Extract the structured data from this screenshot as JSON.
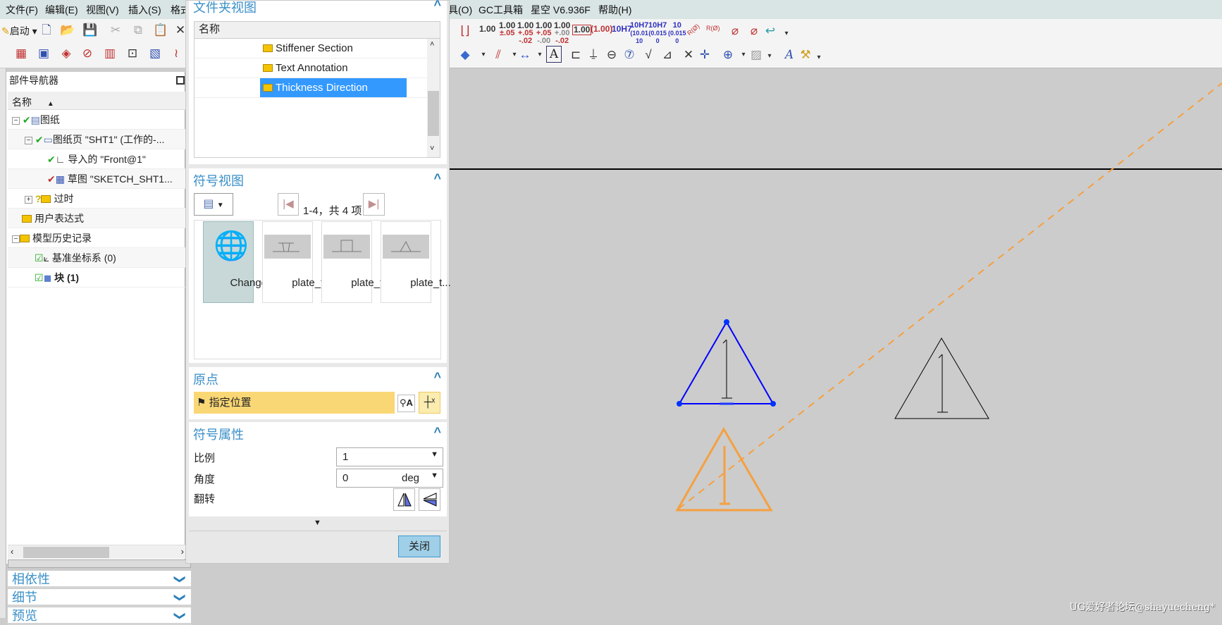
{
  "menubar": {
    "items_left": [
      "文件(F)",
      "编辑(E)",
      "视图(V)",
      "插入(S)",
      "格式"
    ],
    "items_right": [
      "工具(O)",
      "GC工具箱",
      "星空 V6.936F",
      "帮助(H)"
    ]
  },
  "toolbar_left": {
    "start_label": "启动",
    "row1_icons": [
      "new-file-icon",
      "open-folder-icon",
      "save-icon",
      "cut-icon",
      "copy-icon",
      "paste-icon",
      "close-icon"
    ],
    "row2_icons": [
      "view-layout-icon",
      "base-view-icon",
      "section-view-icon",
      "detail-view-icon",
      "break-view-icon",
      "section-line-icon",
      "hatch-icon",
      "broken-view-icon"
    ]
  },
  "toolbar_right": {
    "tolerance_styles": [
      {
        "main": "1.00",
        "upper": "",
        "lower": ""
      },
      {
        "main": "1.00",
        "upper": "±.05",
        "lower": ""
      },
      {
        "main": "1.00",
        "upper": "+.05",
        "lower": "-.02"
      },
      {
        "main": "1.00",
        "upper": "+.05",
        "lower": "-.00"
      },
      {
        "main": "1.00",
        "upper": "+.00",
        "lower": "-.02"
      },
      {
        "main": "1.00",
        "upper": "",
        "lower": ""
      },
      {
        "main": "(1.00)",
        "upper": "",
        "lower": ""
      },
      {
        "main": "10H7",
        "upper": "",
        "lower": ""
      },
      {
        "main": "10H7",
        "upper": "(10.01",
        "lower": "10"
      },
      {
        "main": "10H7",
        "upper": "(0.015",
        "lower": "0"
      },
      {
        "main": "10",
        "upper": "(0.015",
        "lower": "0"
      }
    ],
    "radius_label": "R(Ø)"
  },
  "dialog": {
    "folder_view": {
      "title": "文件夹视图",
      "column": "名称",
      "folders": [
        "Stiffener Section",
        "Text Annotation",
        "Thickness Direction"
      ],
      "selected": "Thickness Direction"
    },
    "symbol_view": {
      "title": "符号视图",
      "pager": "1-4，共 4 项",
      "items": [
        "Change...",
        "plate_t...",
        "plate_t...",
        "plate_t..."
      ]
    },
    "origin": {
      "title": "原点",
      "specify_location": "指定位置"
    },
    "symbol_props": {
      "title": "符号属性",
      "scale_label": "比例",
      "scale_value": "1",
      "angle_label": "角度",
      "angle_value": "0",
      "angle_unit": "deg",
      "flip_label": "翻转"
    },
    "close_label": "关闭"
  },
  "navigator": {
    "title": "部件导航器",
    "column": "名称",
    "rows": [
      "图纸",
      "图纸页 \"SHT1\" (工作的-...",
      "导入的 \"Front@1\"",
      "草图 \"SKETCH_SHT1...",
      "过时",
      "用户表达式",
      "模型历史记录",
      "基准坐标系 (0)",
      "块 (1)"
    ]
  },
  "accordion": [
    "相依性",
    "细节",
    "预览"
  ],
  "canvas": {
    "selected_color": "#0000ff",
    "preview_color": "#f5a040",
    "symbol_text": "1"
  },
  "watermark": "UG爱好者论坛@shayuecheng*"
}
